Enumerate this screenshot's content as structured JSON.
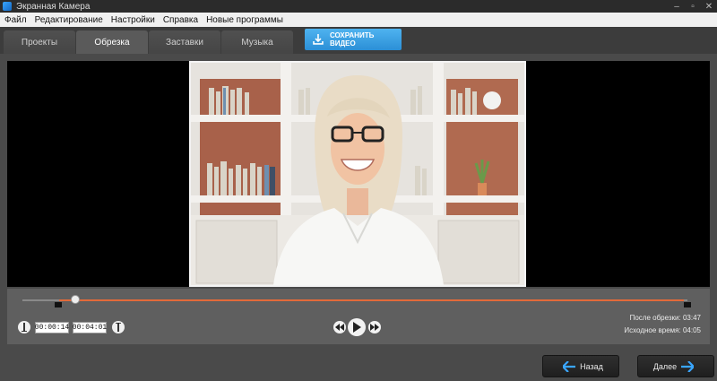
{
  "window": {
    "title": "Экранная Камера",
    "controls": [
      "–",
      "▫",
      "✕"
    ]
  },
  "menu": {
    "items": [
      "Файл",
      "Редактирование",
      "Настройки",
      "Справка",
      "Новые программы"
    ]
  },
  "tabs": [
    {
      "label": "Проекты"
    },
    {
      "label": "Обрезка",
      "active": true
    },
    {
      "label": "Заставки"
    },
    {
      "label": "Музыка"
    }
  ],
  "save_button": {
    "label": "СОХРАНИТЬ ВИДЕО",
    "icon": "download-icon"
  },
  "timeline": {
    "start_time": "00:00:14",
    "end_time": "00:04:01",
    "playhead_fraction": 0.0
  },
  "info": {
    "after_trim_label": "После обрезки:",
    "after_trim_value": "03:47",
    "source_label": "Исходное время:",
    "source_value": "04:05"
  },
  "footer": {
    "back_label": "Назад",
    "next_label": "Далее"
  },
  "colors": {
    "accent": "#2b8fd6",
    "selection": "#e26a3a",
    "arrow": "#3aa6ff"
  }
}
